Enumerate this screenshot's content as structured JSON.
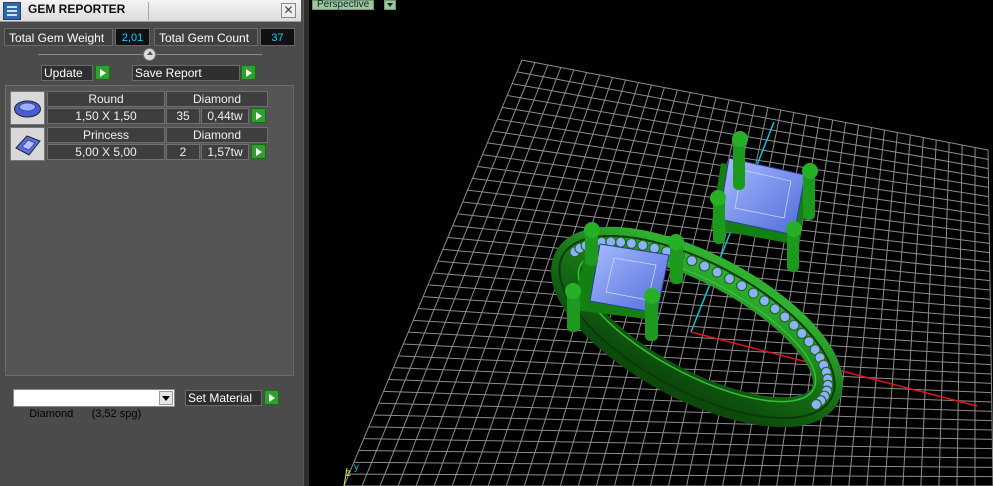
{
  "window": {
    "title": "GEM REPORTER",
    "close_glyph": "✕",
    "icon": "gem-reporter-icon"
  },
  "totals": {
    "weight_label": "Total Gem Weight",
    "weight_value": "2,01",
    "count_label": "Total Gem Count",
    "count_value": "37"
  },
  "buttons": {
    "update": "Update",
    "save_report": "Save Report",
    "set_material": "Set Material"
  },
  "gems": [
    {
      "cut": "Round",
      "material": "Diamond",
      "size": "1,50 X 1,50",
      "count": "35",
      "weight": "0,44tw",
      "icon": "round-gem-icon"
    },
    {
      "cut": "Princess",
      "material": "Diamond",
      "size": "5,00 X 5,00",
      "count": "2",
      "weight": "1,57tw",
      "icon": "princess-gem-icon"
    }
  ],
  "material_select": {
    "value": "Diamond      (3,52 spg)"
  },
  "viewport": {
    "label": "Perspective",
    "axis_z": "z",
    "axis_y": "y"
  },
  "colors": {
    "metal": "#1f8a1f",
    "gem": "#6f8ff0",
    "grid": "#8c8c8c",
    "value_text": "#0fd4ff",
    "play_button": "#2ea02e"
  }
}
